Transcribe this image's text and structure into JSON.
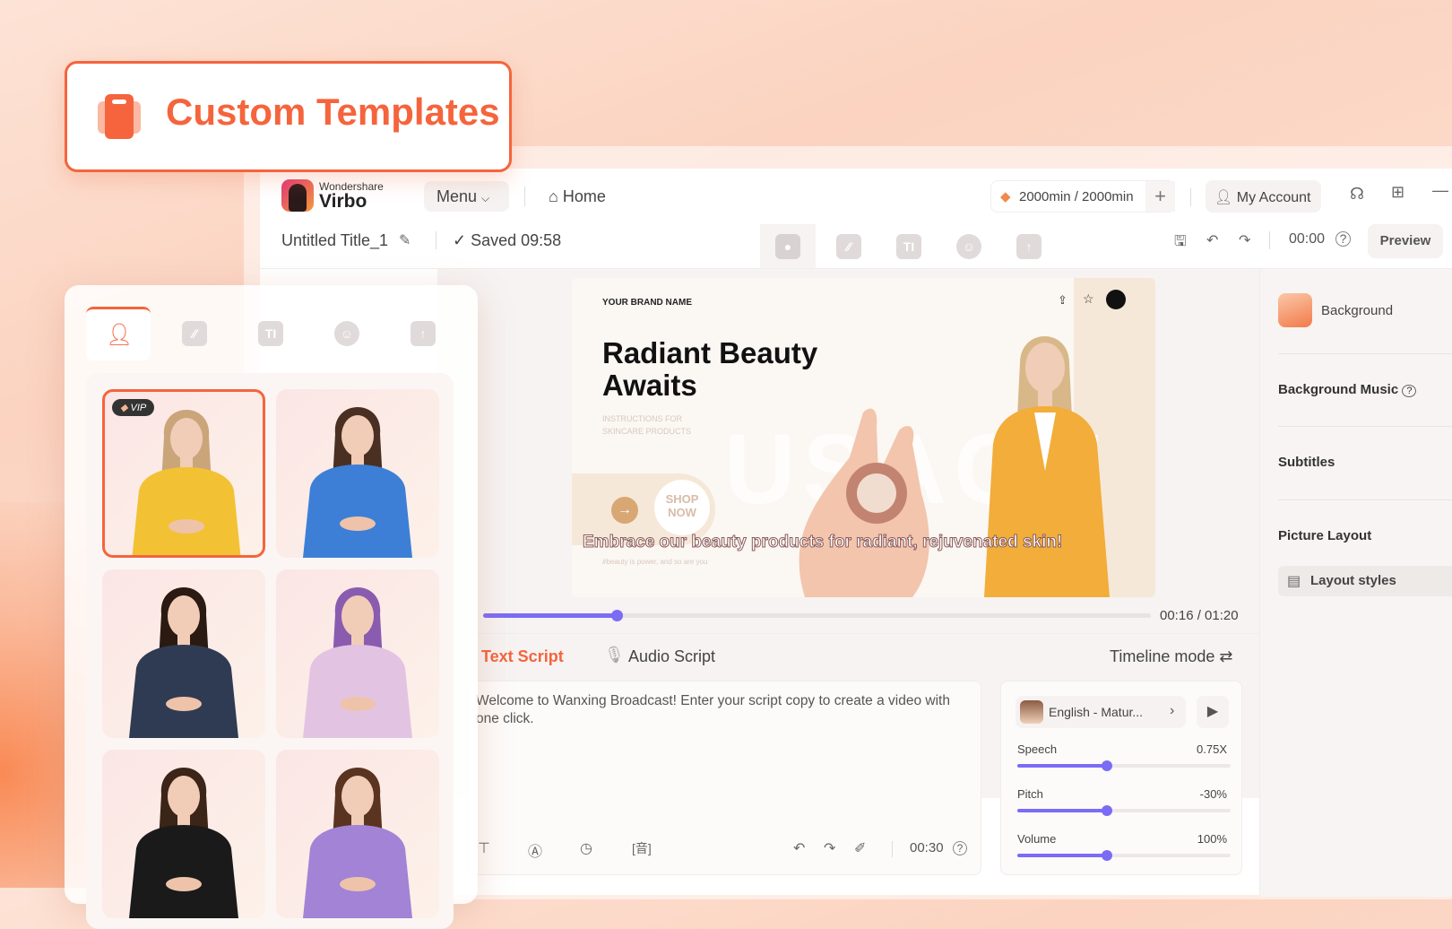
{
  "badge": {
    "title": "Custom Templates",
    "icon": "clipboard-icon",
    "accent": "#f5643c"
  },
  "app": {
    "brand_top": "Wondershare",
    "brand_name": "Virbo",
    "menu_label": "Menu",
    "home_label": "Home",
    "credits": "2000min / 2000min",
    "account_label": "My Account",
    "project_title": "Untitled Title_1",
    "saved_status": "Saved 09:58",
    "duration": "00:00",
    "preview_label": "Preview"
  },
  "left_panel": {
    "tabs": [
      "avatar-icon",
      "sticker-icon",
      "text-icon",
      "emoji-icon",
      "upload-icon"
    ],
    "vip_label": "VIP",
    "avatars": [
      {
        "outfit": "#f2c234",
        "hair": "#caa57a",
        "selected": true
      },
      {
        "outfit": "#3d7fd6",
        "hair": "#4a3022",
        "selected": false
      },
      {
        "outfit": "#2f3b52",
        "hair": "#2b1a12",
        "selected": false
      },
      {
        "outfit": "#e2c4e2",
        "hair": "#8a5cb0",
        "selected": false
      },
      {
        "outfit": "#1a1a1a",
        "hair": "#3b2418",
        "selected": false
      },
      {
        "outfit": "#a283d6",
        "hair": "#5a3420",
        "selected": false
      }
    ]
  },
  "canvas": {
    "brand_name": "YOUR BRAND NAME",
    "headline_1": "Radiant Beauty",
    "headline_2": "Awaits",
    "sub_1": "INSTRUCTIONS FOR",
    "sub_2": "SKINCARE PRODUCTS",
    "watermark": "USAGE",
    "shop_1": "SHOP",
    "shop_2": "NOW",
    "tagline": "#beauty is power, and so are you",
    "subtitle": "Embrace our beauty products for radiant, rejuvenated skin!",
    "progress": 0.2,
    "time": "00:16 / 01:20",
    "progress_color": "#7b6cf6"
  },
  "script": {
    "tab_text": "Text Script",
    "tab_audio": "Audio Script",
    "timeline_mode": "Timeline mode",
    "text": "Welcome to Wanxing Broadcast! Enter your script copy to create a video with one click.",
    "duration": "00:30"
  },
  "voice": {
    "name": "English - Matur...",
    "controls": [
      {
        "label": "Speech",
        "value": "0.75X",
        "level": 0.42
      },
      {
        "label": "Pitch",
        "value": "-30%",
        "level": 0.42
      },
      {
        "label": "Volume",
        "value": "100%",
        "level": 0.42
      }
    ]
  },
  "right_panel": {
    "background": "Background",
    "background_music": "Background Music",
    "subtitles": "Subtitles",
    "picture_layout": "Picture Layout",
    "layout_styles": "Layout styles"
  }
}
